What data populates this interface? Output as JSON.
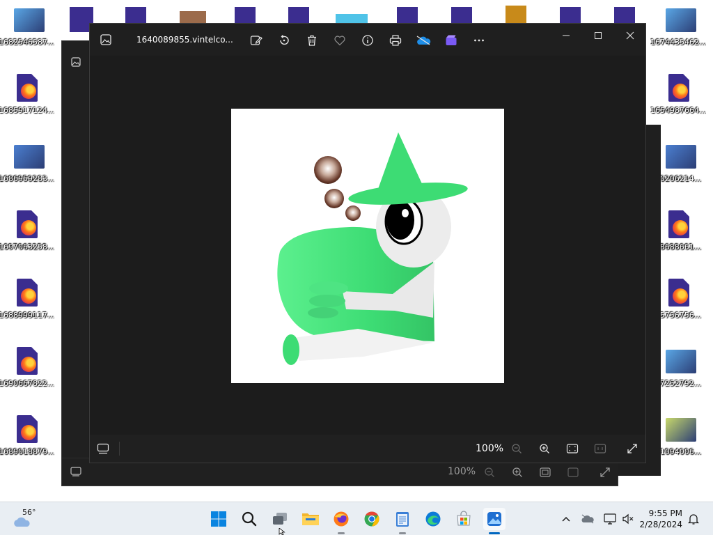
{
  "desktop": {
    "left_icons": [
      {
        "label": "1682546587...",
        "kind": "picture"
      },
      {
        "label": "1685917124...",
        "kind": "firefox-doc"
      },
      {
        "label": "1686959283...",
        "kind": "picture"
      },
      {
        "label": "1697063258...",
        "kind": "firefox-doc"
      },
      {
        "label": "1688999117...",
        "kind": "firefox-doc"
      },
      {
        "label": "1690667822...",
        "kind": "firefox-doc"
      },
      {
        "label": "1689018879...",
        "kind": "firefox-doc"
      }
    ],
    "right_icons": [
      {
        "label": "1674435462...",
        "kind": "picture"
      },
      {
        "label": "1654987664...",
        "kind": "firefox-doc"
      },
      {
        "label": "80206214...",
        "kind": "picture"
      },
      {
        "label": "58688661...",
        "kind": "firefox-doc"
      },
      {
        "label": "65756756...",
        "kind": "firefox-doc"
      },
      {
        "label": "67252792...",
        "kind": "picture"
      },
      {
        "label": "01094006...",
        "kind": "picture"
      }
    ]
  },
  "photos_window": {
    "title": "1640089855.vintelco...",
    "toolbar_icons": [
      "edit-image-icon",
      "rotate-icon",
      "delete-icon",
      "favorite-icon",
      "info-icon",
      "print-icon",
      "onedrive-icon",
      "clipchamp-icon",
      "more-icon"
    ],
    "zoom_label": "100%"
  },
  "back_window": {
    "zoom_label": "100%"
  },
  "taskbar": {
    "weather_temp": "56°",
    "clock_time": "9:55 PM",
    "clock_date": "2/28/2024"
  },
  "colors": {
    "window_bg": "#1c1c1c",
    "taskbar_bg": "#e9eef3",
    "accent": "#0067c0",
    "character_green": "#3ddc74"
  }
}
